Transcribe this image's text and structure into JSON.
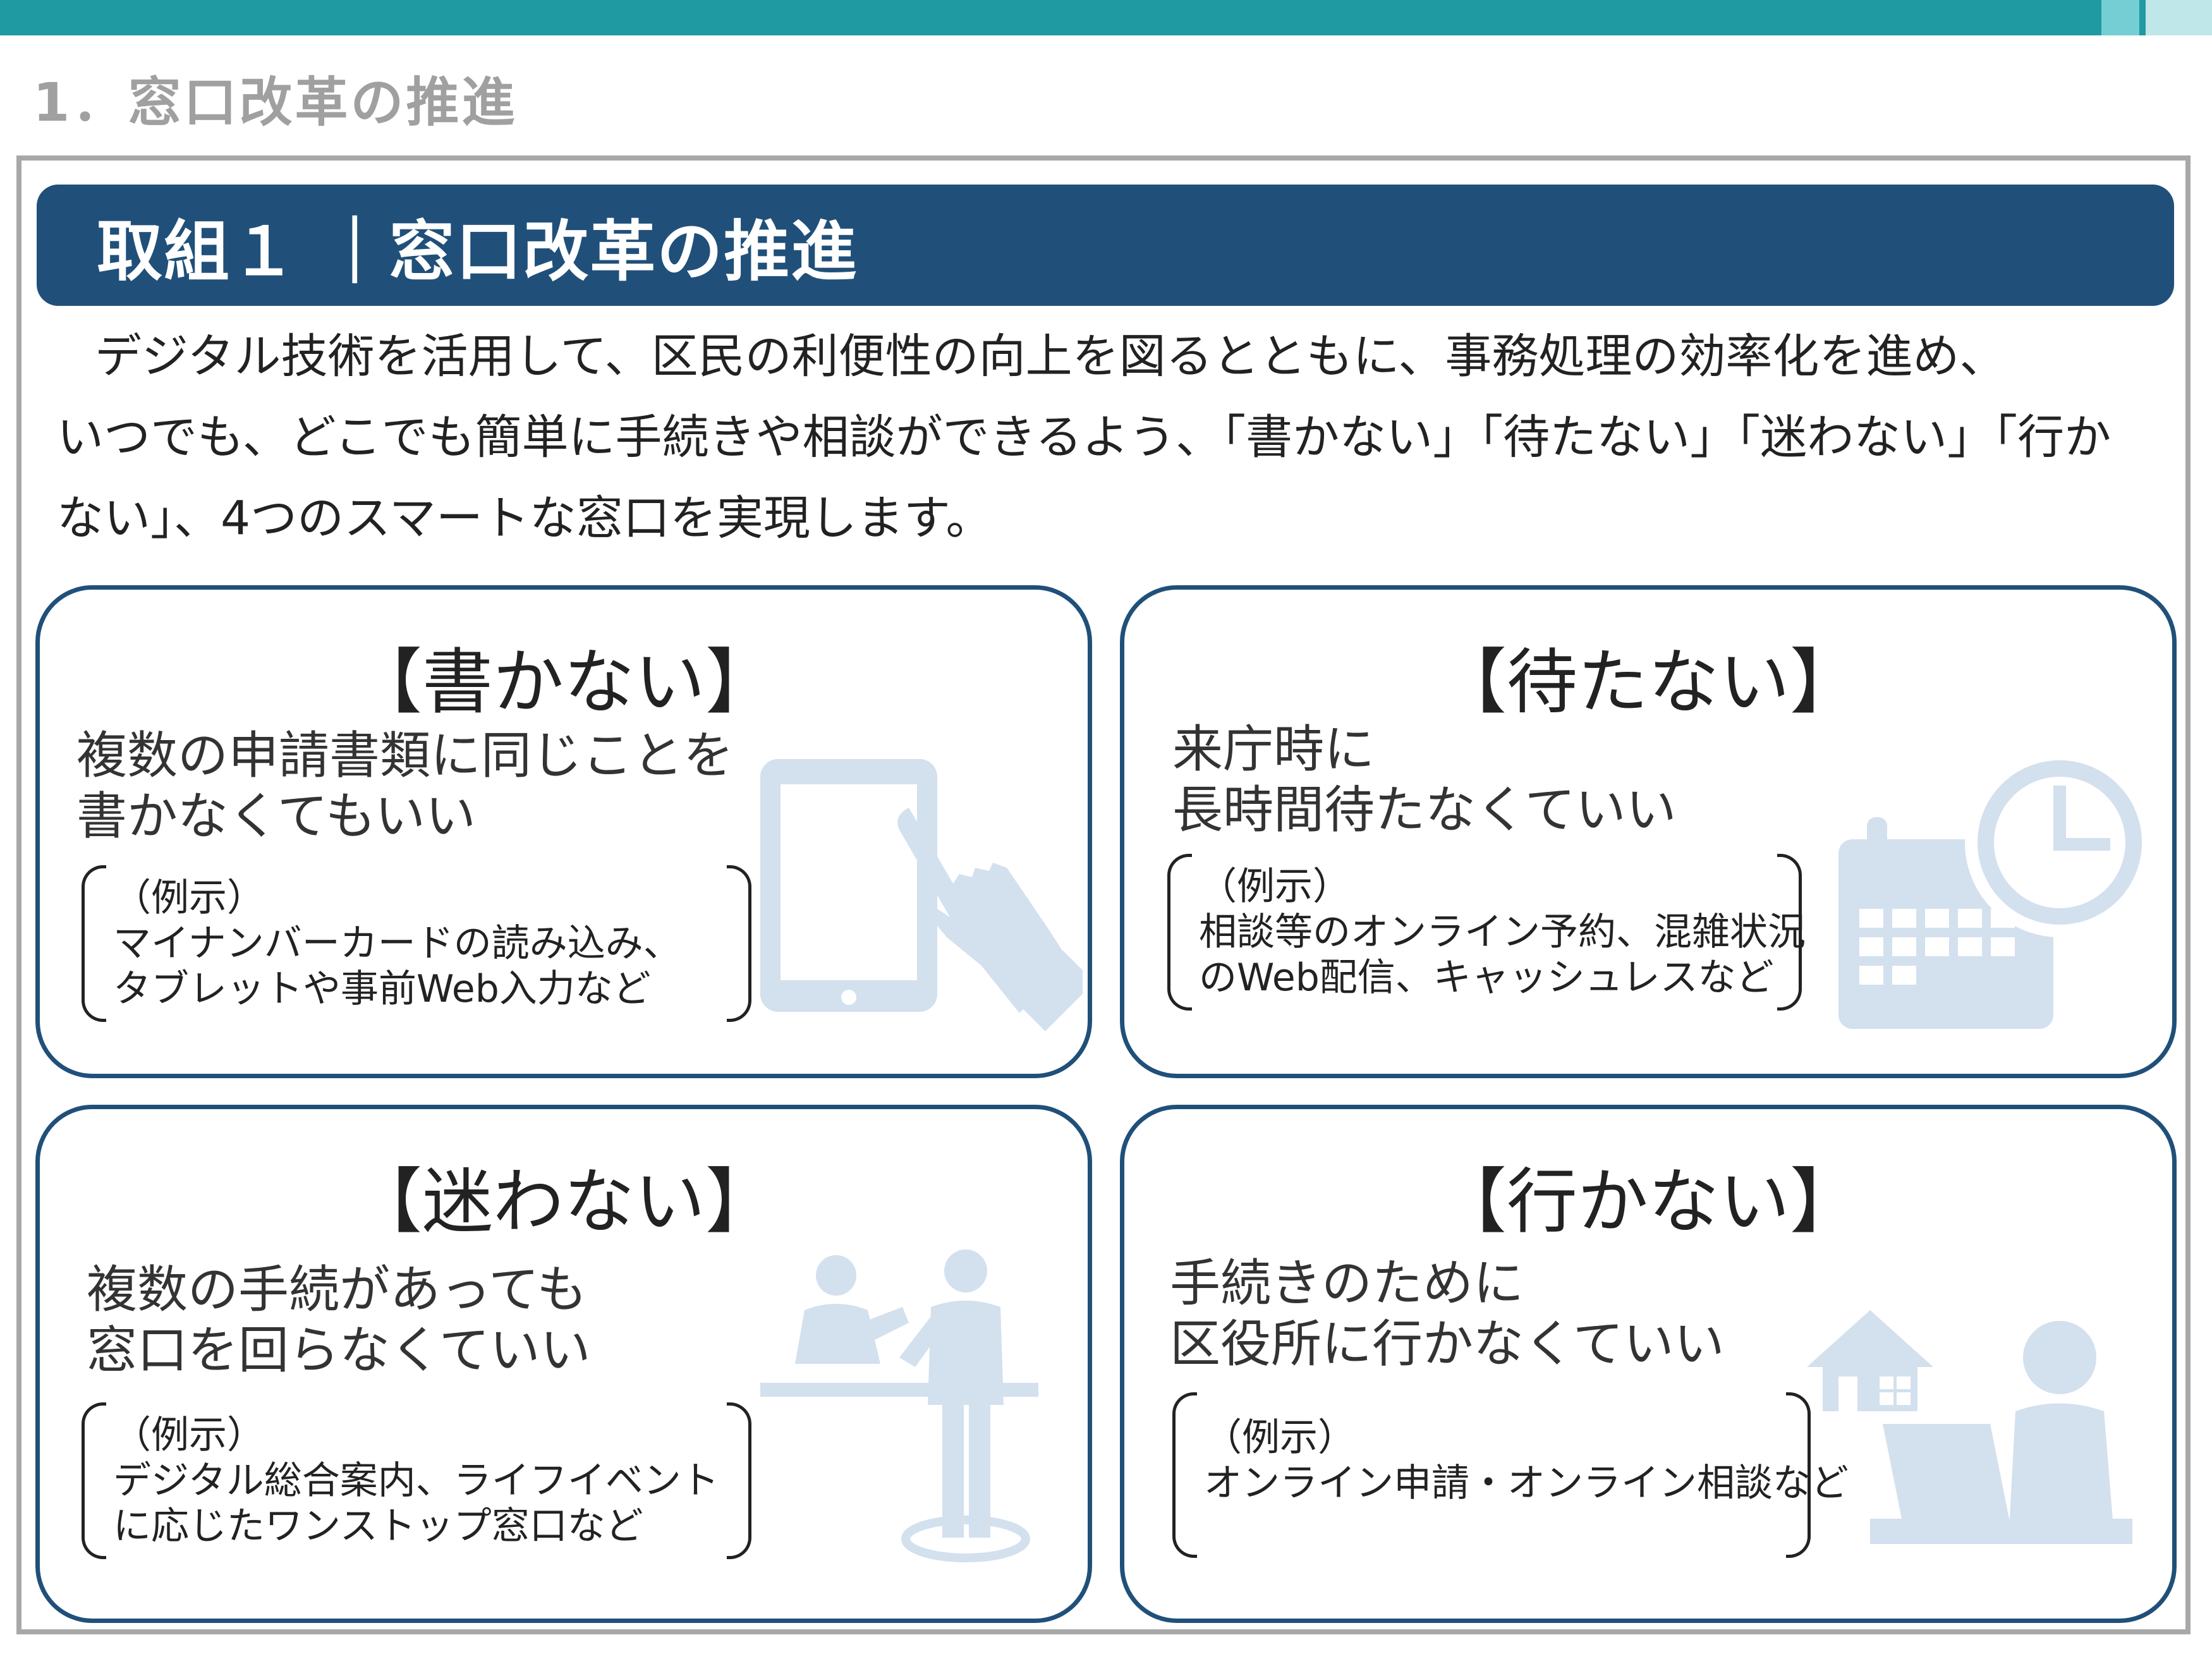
{
  "header": {
    "section_title": "1．窓口改革の推進"
  },
  "banner": {
    "title": "取組１ ｜窓口改革の推進"
  },
  "intro": {
    "lines": [
      "デジタル技術を活用して、区民の利便性の向上を図るとともに、事務処理の効率化を進め、",
      "いつでも、どこでも簡単に手続きや相談ができるよう、「書かない」「待たない」「迷わない」「行か",
      "ない」、4つのスマートな窓口を実現します。"
    ]
  },
  "cards": [
    {
      "title": "【書かない】",
      "desc": [
        "複数の申請書類に同じことを",
        "書かなくてもいい"
      ],
      "example": [
        "（例示）",
        "マイナンバーカードの読み込み、",
        "タブレットや事前Web入力など"
      ],
      "icon": "tablet-hand-icon"
    },
    {
      "title": "【待たない】",
      "desc": [
        "来庁時に",
        "長時間待たなくていい"
      ],
      "example": [
        "（例示）",
        "相談等のオンライン予約、混雑状況",
        "のWeb配信、キャッシュレスなど"
      ],
      "icon": "calendar-clock-icon"
    },
    {
      "title": "【迷わない】",
      "desc": [
        "複数の手続があっても",
        "窓口を回らなくていい"
      ],
      "example": [
        "（例示）",
        "デジタル総合案内、ライフイベント",
        "に応じたワンストップ窓口など"
      ],
      "icon": "counter-people-icon"
    },
    {
      "title": "【行かない】",
      "desc": [
        "手続きのために",
        "区役所に行かなくていい"
      ],
      "example": [
        "（例示）",
        "オンライン申請・オンライン相談など"
      ],
      "icon": "home-laptop-icon"
    }
  ],
  "colors": {
    "accent_teal": "#1f9aa3",
    "banner_navy": "#20507a",
    "icon_light_blue": "#d3e0ee",
    "frame_gray": "#a8a8a8"
  }
}
